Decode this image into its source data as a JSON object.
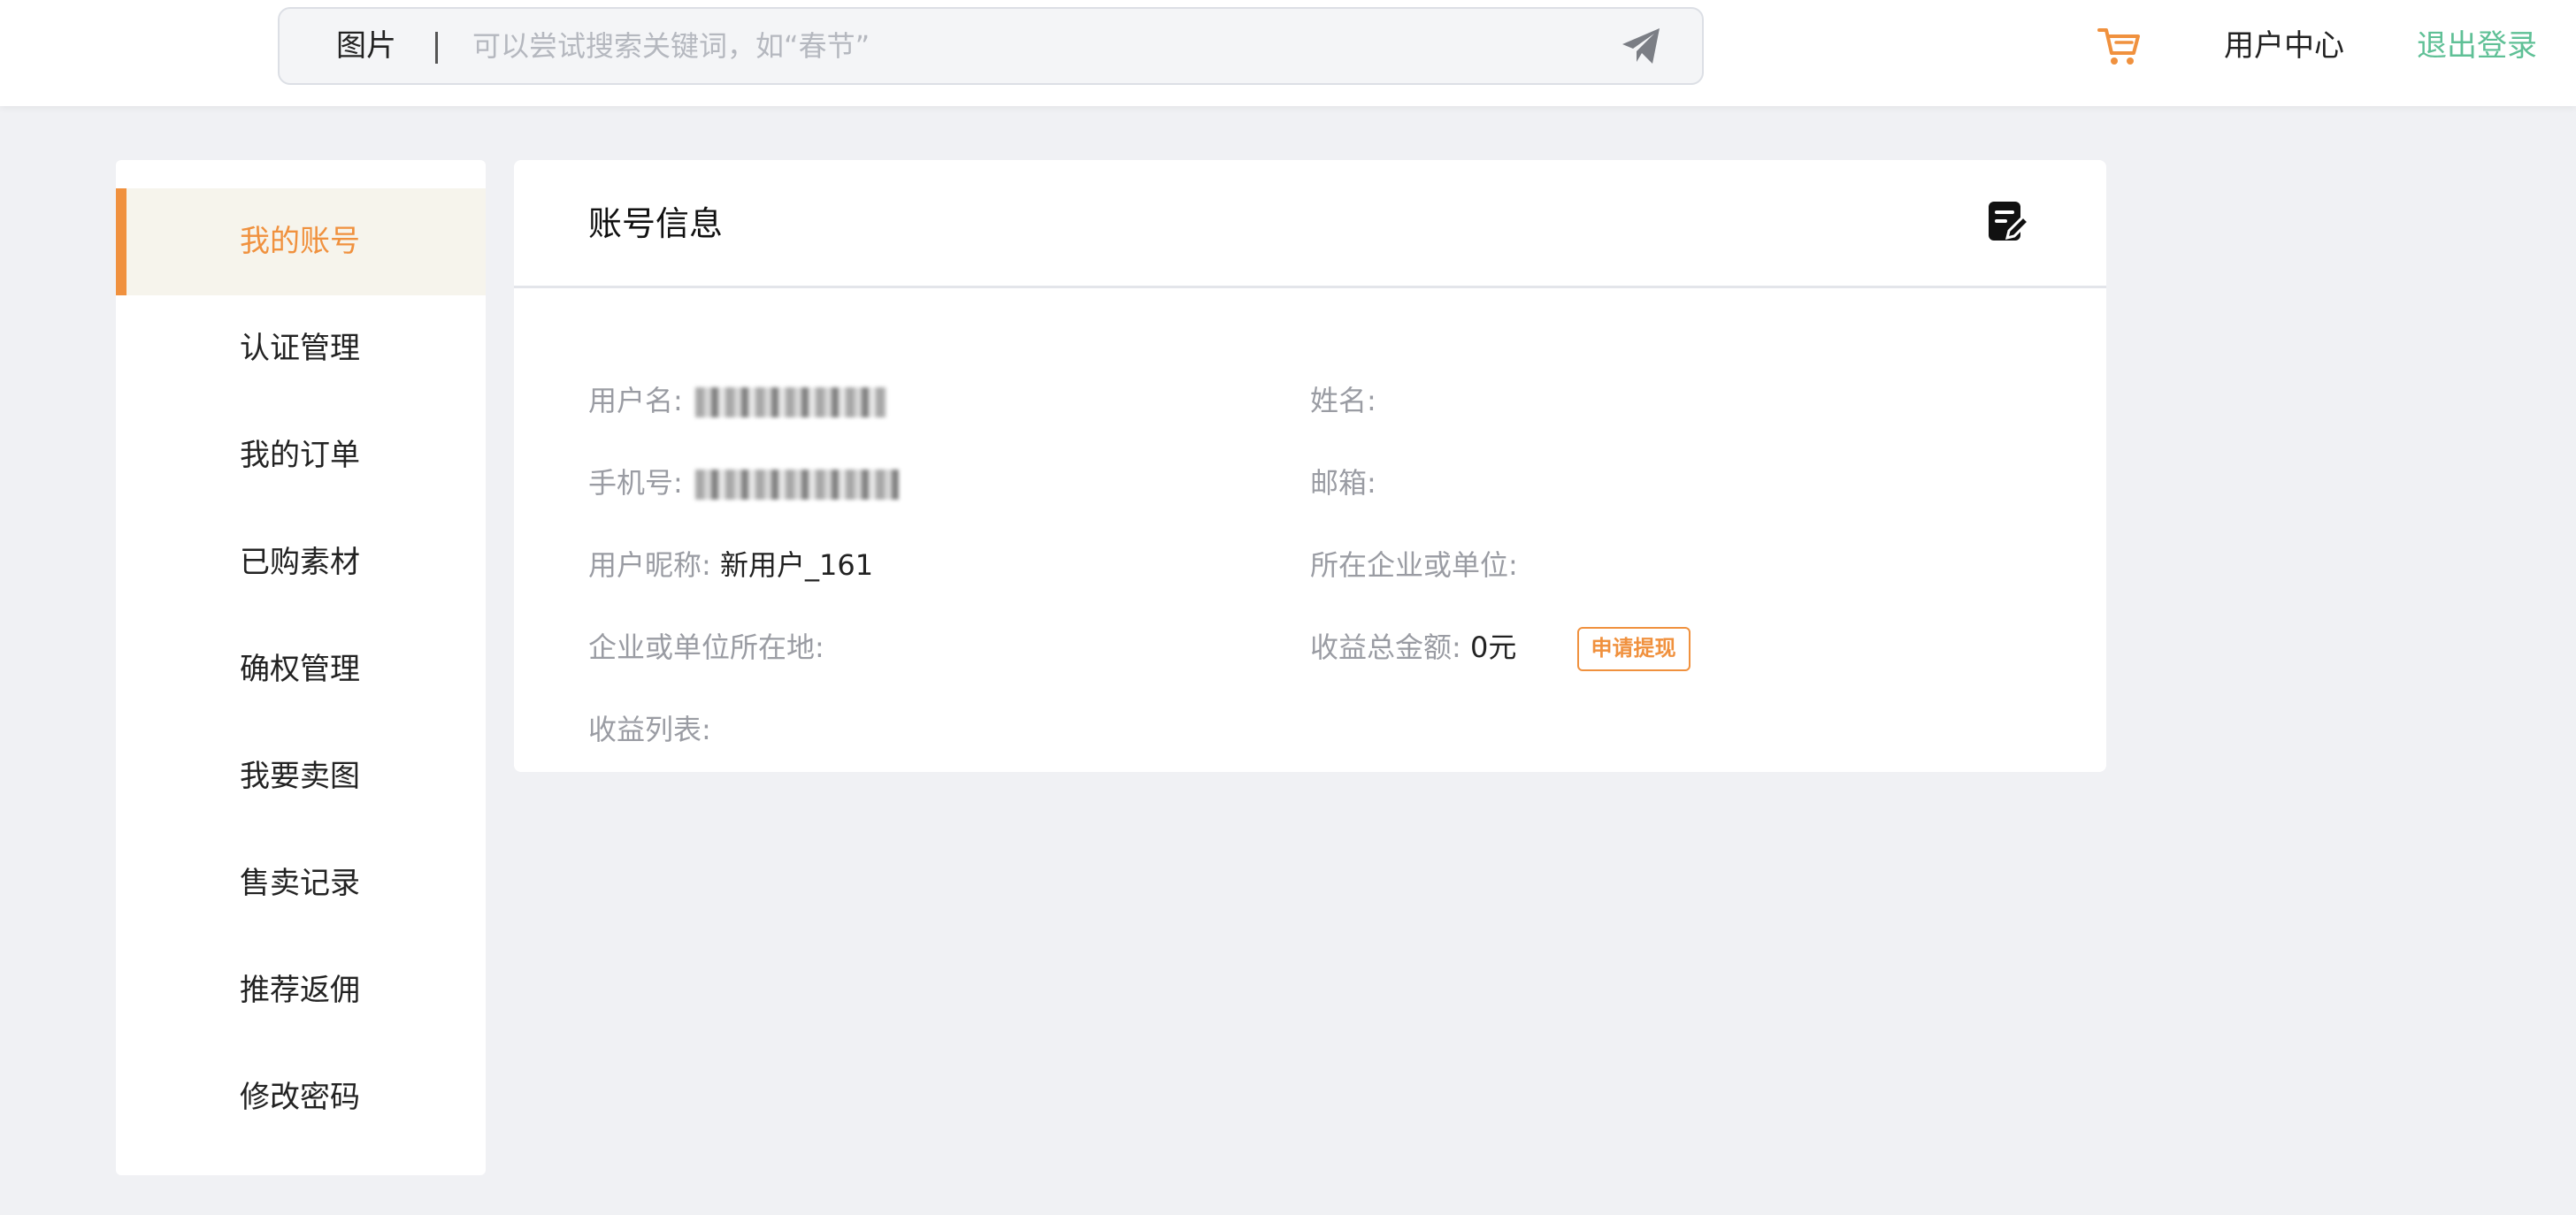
{
  "header": {
    "search_type": "图片",
    "search_placeholder": "可以尝试搜索关键词，如“春节”",
    "user_center": "用户中心",
    "logout": "退出登录",
    "accent_color": "#f0913e",
    "logout_color": "#5fc096"
  },
  "sidebar": {
    "items": [
      {
        "label": "我的账号",
        "active": true
      },
      {
        "label": "认证管理"
      },
      {
        "label": "我的订单"
      },
      {
        "label": "已购素材"
      },
      {
        "label": "确权管理"
      },
      {
        "label": "我要卖图"
      },
      {
        "label": "售卖记录"
      },
      {
        "label": "推荐返佣"
      },
      {
        "label": "修改密码"
      }
    ]
  },
  "account": {
    "title": "账号信息",
    "username_label": "用户名:",
    "name_label": "姓名:",
    "phone_label": "手机号:",
    "email_label": "邮箱:",
    "nickname_label": "用户昵称:",
    "nickname_value": "新用户_161",
    "company_label": "所在企业或单位:",
    "company_location_label": "企业或单位所在地:",
    "earnings_total_label": "收益总金额:",
    "earnings_total_value": "0元",
    "withdraw_button": "申请提现",
    "earnings_list_label": "收益列表:"
  },
  "icons": {
    "send": "paper-plane-icon",
    "cart": "cart-icon",
    "edit": "edit-note-icon"
  }
}
